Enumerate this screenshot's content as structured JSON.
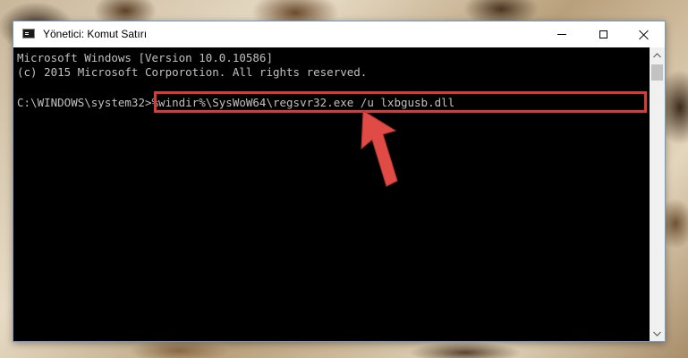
{
  "window": {
    "title": "Yönetici: Komut Satırı"
  },
  "console": {
    "lines": [
      "Microsoft Windows [Version 10.0.10586]",
      "(c) 2015 Microsoft Corporotion. All rights reserved."
    ],
    "prompt": "C:\\WINDOWS\\system32>",
    "command": "%windir%\\SysWoW64\\regsvr32.exe /u lxbgusb.dll"
  },
  "colors": {
    "highlight": "#d83a3a",
    "arrow": "#e14b45",
    "console_bg": "#000000",
    "console_fg": "#c0c0c0"
  },
  "icons": {
    "app": "cmd-icon",
    "minimize": "minimize-icon",
    "maximize": "maximize-icon",
    "close": "close-icon",
    "scroll_up": "chevron-up-icon",
    "scroll_down": "chevron-down-icon",
    "annotation": "red-arrow-icon"
  }
}
